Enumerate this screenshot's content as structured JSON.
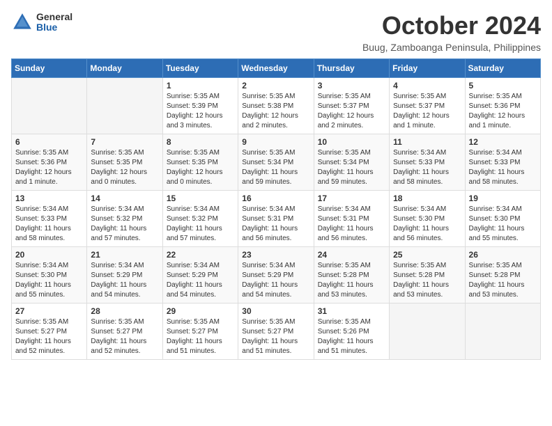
{
  "header": {
    "logo_general": "General",
    "logo_blue": "Blue",
    "month_title": "October 2024",
    "location": "Buug, Zamboanga Peninsula, Philippines"
  },
  "days_of_week": [
    "Sunday",
    "Monday",
    "Tuesday",
    "Wednesday",
    "Thursday",
    "Friday",
    "Saturday"
  ],
  "weeks": [
    [
      {
        "day": "",
        "content": ""
      },
      {
        "day": "",
        "content": ""
      },
      {
        "day": "1",
        "content": "Sunrise: 5:35 AM\nSunset: 5:39 PM\nDaylight: 12 hours\nand 3 minutes."
      },
      {
        "day": "2",
        "content": "Sunrise: 5:35 AM\nSunset: 5:38 PM\nDaylight: 12 hours\nand 2 minutes."
      },
      {
        "day": "3",
        "content": "Sunrise: 5:35 AM\nSunset: 5:37 PM\nDaylight: 12 hours\nand 2 minutes."
      },
      {
        "day": "4",
        "content": "Sunrise: 5:35 AM\nSunset: 5:37 PM\nDaylight: 12 hours\nand 1 minute."
      },
      {
        "day": "5",
        "content": "Sunrise: 5:35 AM\nSunset: 5:36 PM\nDaylight: 12 hours\nand 1 minute."
      }
    ],
    [
      {
        "day": "6",
        "content": "Sunrise: 5:35 AM\nSunset: 5:36 PM\nDaylight: 12 hours\nand 1 minute."
      },
      {
        "day": "7",
        "content": "Sunrise: 5:35 AM\nSunset: 5:35 PM\nDaylight: 12 hours\nand 0 minutes."
      },
      {
        "day": "8",
        "content": "Sunrise: 5:35 AM\nSunset: 5:35 PM\nDaylight: 12 hours\nand 0 minutes."
      },
      {
        "day": "9",
        "content": "Sunrise: 5:35 AM\nSunset: 5:34 PM\nDaylight: 11 hours\nand 59 minutes."
      },
      {
        "day": "10",
        "content": "Sunrise: 5:35 AM\nSunset: 5:34 PM\nDaylight: 11 hours\nand 59 minutes."
      },
      {
        "day": "11",
        "content": "Sunrise: 5:34 AM\nSunset: 5:33 PM\nDaylight: 11 hours\nand 58 minutes."
      },
      {
        "day": "12",
        "content": "Sunrise: 5:34 AM\nSunset: 5:33 PM\nDaylight: 11 hours\nand 58 minutes."
      }
    ],
    [
      {
        "day": "13",
        "content": "Sunrise: 5:34 AM\nSunset: 5:33 PM\nDaylight: 11 hours\nand 58 minutes."
      },
      {
        "day": "14",
        "content": "Sunrise: 5:34 AM\nSunset: 5:32 PM\nDaylight: 11 hours\nand 57 minutes."
      },
      {
        "day": "15",
        "content": "Sunrise: 5:34 AM\nSunset: 5:32 PM\nDaylight: 11 hours\nand 57 minutes."
      },
      {
        "day": "16",
        "content": "Sunrise: 5:34 AM\nSunset: 5:31 PM\nDaylight: 11 hours\nand 56 minutes."
      },
      {
        "day": "17",
        "content": "Sunrise: 5:34 AM\nSunset: 5:31 PM\nDaylight: 11 hours\nand 56 minutes."
      },
      {
        "day": "18",
        "content": "Sunrise: 5:34 AM\nSunset: 5:30 PM\nDaylight: 11 hours\nand 56 minutes."
      },
      {
        "day": "19",
        "content": "Sunrise: 5:34 AM\nSunset: 5:30 PM\nDaylight: 11 hours\nand 55 minutes."
      }
    ],
    [
      {
        "day": "20",
        "content": "Sunrise: 5:34 AM\nSunset: 5:30 PM\nDaylight: 11 hours\nand 55 minutes."
      },
      {
        "day": "21",
        "content": "Sunrise: 5:34 AM\nSunset: 5:29 PM\nDaylight: 11 hours\nand 54 minutes."
      },
      {
        "day": "22",
        "content": "Sunrise: 5:34 AM\nSunset: 5:29 PM\nDaylight: 11 hours\nand 54 minutes."
      },
      {
        "day": "23",
        "content": "Sunrise: 5:34 AM\nSunset: 5:29 PM\nDaylight: 11 hours\nand 54 minutes."
      },
      {
        "day": "24",
        "content": "Sunrise: 5:35 AM\nSunset: 5:28 PM\nDaylight: 11 hours\nand 53 minutes."
      },
      {
        "day": "25",
        "content": "Sunrise: 5:35 AM\nSunset: 5:28 PM\nDaylight: 11 hours\nand 53 minutes."
      },
      {
        "day": "26",
        "content": "Sunrise: 5:35 AM\nSunset: 5:28 PM\nDaylight: 11 hours\nand 53 minutes."
      }
    ],
    [
      {
        "day": "27",
        "content": "Sunrise: 5:35 AM\nSunset: 5:27 PM\nDaylight: 11 hours\nand 52 minutes."
      },
      {
        "day": "28",
        "content": "Sunrise: 5:35 AM\nSunset: 5:27 PM\nDaylight: 11 hours\nand 52 minutes."
      },
      {
        "day": "29",
        "content": "Sunrise: 5:35 AM\nSunset: 5:27 PM\nDaylight: 11 hours\nand 51 minutes."
      },
      {
        "day": "30",
        "content": "Sunrise: 5:35 AM\nSunset: 5:27 PM\nDaylight: 11 hours\nand 51 minutes."
      },
      {
        "day": "31",
        "content": "Sunrise: 5:35 AM\nSunset: 5:26 PM\nDaylight: 11 hours\nand 51 minutes."
      },
      {
        "day": "",
        "content": ""
      },
      {
        "day": "",
        "content": ""
      }
    ]
  ]
}
